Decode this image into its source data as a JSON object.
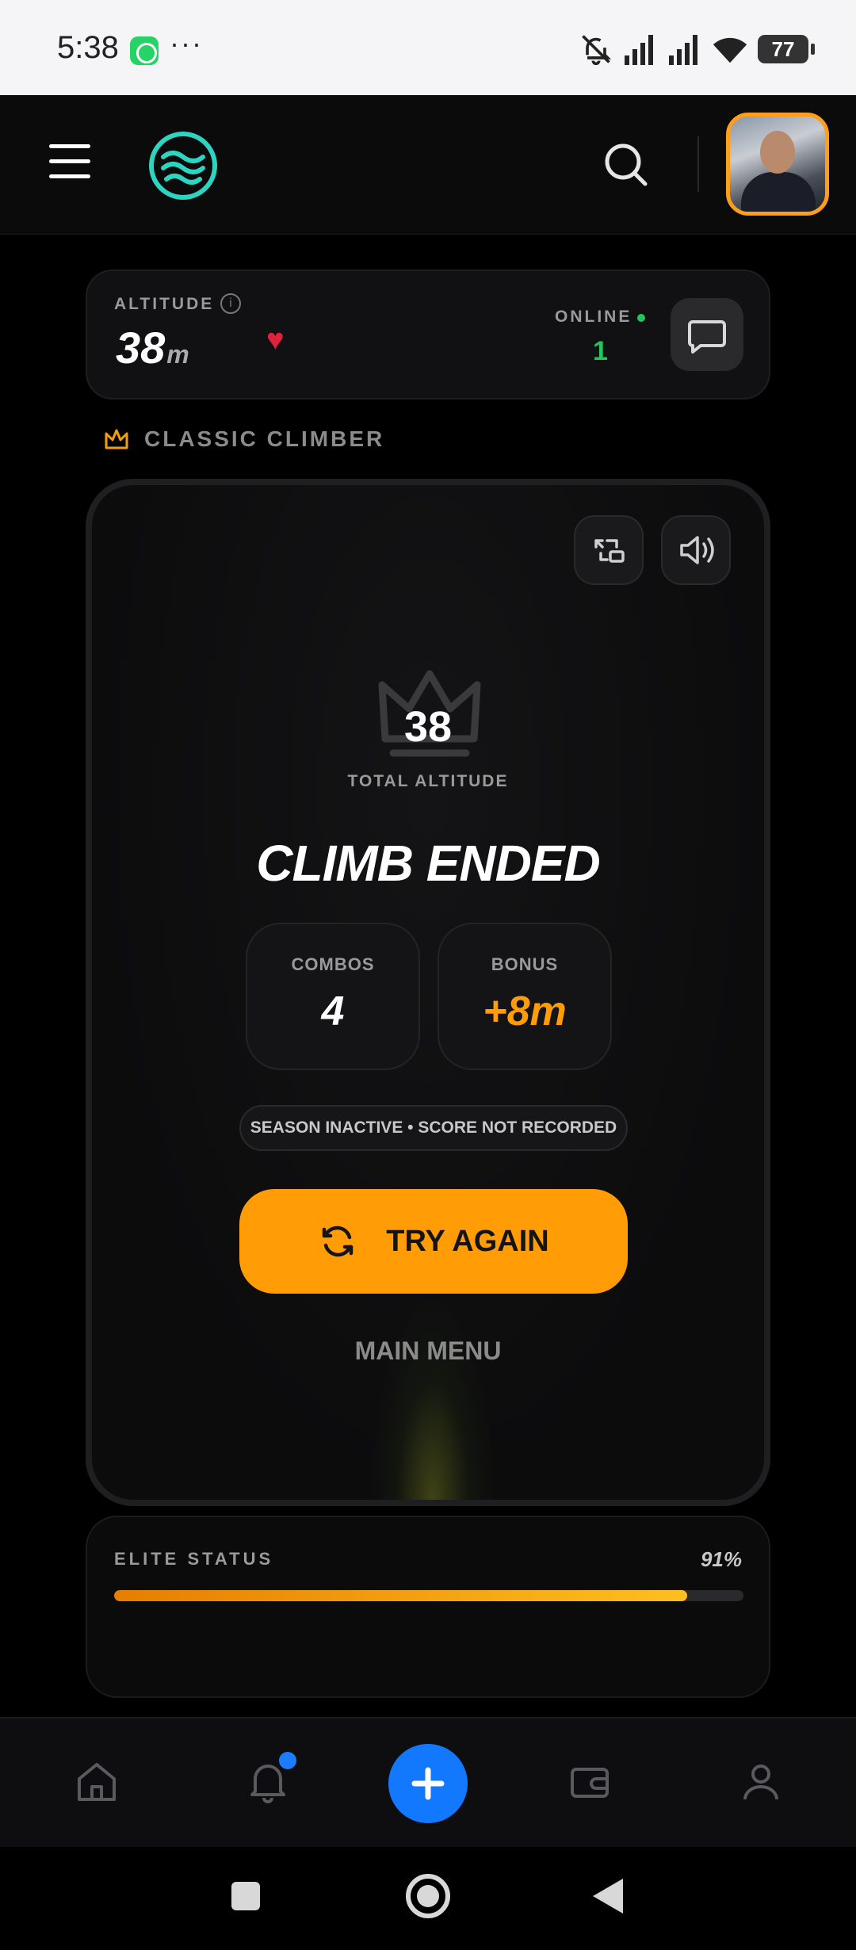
{
  "status_bar": {
    "time": "5:38",
    "dots": "···",
    "battery": "77",
    "icons": [
      "whatsapp-icon",
      "mute-icon",
      "signal-icon",
      "signal-icon",
      "wifi-icon",
      "battery-icon"
    ]
  },
  "header": {
    "icons": [
      "menu-icon",
      "app-logo",
      "search-icon",
      "avatar"
    ]
  },
  "altitude_bar": {
    "label": "ALTITUDE",
    "value": "38",
    "unit": "m",
    "online_label": "ONLINE",
    "online_count": "1"
  },
  "mode": {
    "label": "CLASSIC CLIMBER"
  },
  "game": {
    "score": "38",
    "score_label": "TOTAL ALTITUDE",
    "headline": "CLIMB ENDED",
    "combos_label": "COMBOS",
    "combos_value": "4",
    "bonus_label": "BONUS",
    "bonus_value": "+8m",
    "season_notice": "SEASON INACTIVE • SCORE NOT RECORDED",
    "try_again": "TRY AGAIN",
    "main_menu": "MAIN MENU"
  },
  "elite": {
    "label": "ELITE STATUS",
    "percent_text": "91%",
    "progress": 0.91
  },
  "bottom_nav": {
    "items": [
      "home-icon",
      "bell-icon",
      "add-icon",
      "wallet-icon",
      "profile-icon"
    ]
  },
  "colors": {
    "accent": "#ff9c06",
    "online": "#22c55e",
    "fab": "#1279ff",
    "logo": "#2dd4bf"
  }
}
